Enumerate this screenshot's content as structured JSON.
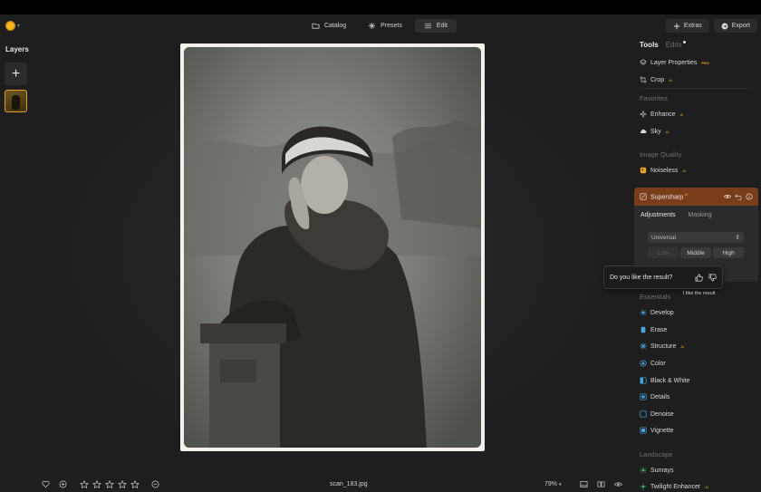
{
  "topbar": {
    "modes": [
      {
        "label": "Catalog",
        "icon": "folder-icon"
      },
      {
        "label": "Presets",
        "icon": "sparkle-icon"
      },
      {
        "label": "Edit",
        "icon": "sliders-icon",
        "active": true
      }
    ],
    "extras_label": "Extras",
    "export_label": "Export"
  },
  "layers": {
    "title": "Layers",
    "add_symbol": "+"
  },
  "panel": {
    "tabs": {
      "tools": "Tools",
      "edits": "Edits"
    },
    "items_top": [
      {
        "label": "Layer Properties",
        "badge": "PRO",
        "icon": "layers-icon"
      },
      {
        "label": "Crop",
        "badge": "AI",
        "icon": "crop-icon"
      }
    ],
    "favorites": {
      "title": "Favorites",
      "items": [
        {
          "label": "Enhance",
          "badge": "AI",
          "icon": "enhance-icon"
        },
        {
          "label": "Sky",
          "badge": "AI",
          "icon": "cloud-icon"
        }
      ]
    },
    "image_quality": {
      "title": "Image Quality",
      "items": [
        {
          "label": "Noiseless",
          "badge": "AI",
          "icon": "noiseless-icon"
        }
      ]
    },
    "supersharp": {
      "title": "Supersharp",
      "badge": "AI",
      "tabs": [
        "Adjustments",
        "Masking"
      ],
      "mode_select": "Universal",
      "levels": [
        "Low",
        "Middle",
        "High"
      ]
    },
    "essentials": {
      "title": "Essentials",
      "items": [
        {
          "label": "Develop",
          "icon": "develop-icon"
        },
        {
          "label": "Erase",
          "icon": "erase-icon"
        },
        {
          "label": "Structure",
          "badge": "AI",
          "icon": "structure-icon"
        },
        {
          "label": "Color",
          "icon": "color-icon"
        },
        {
          "label": "Black & White",
          "icon": "black-white-icon"
        },
        {
          "label": "Details",
          "icon": "details-icon"
        },
        {
          "label": "Denoise",
          "icon": "denoise-icon"
        },
        {
          "label": "Vignette",
          "icon": "vignette-icon"
        }
      ]
    },
    "landscape": {
      "title": "Landscape",
      "items": [
        {
          "label": "Sunrays",
          "icon": "sunrays-icon"
        },
        {
          "label": "Twilight Enhancer",
          "badge": "AI",
          "icon": "twilight-icon"
        }
      ]
    }
  },
  "feedback": {
    "question": "Do you like the result?",
    "tooltip": "I like the result"
  },
  "bottombar": {
    "filename": "scan_183.jpg",
    "zoom": "79%",
    "rating": 0,
    "max_rating": 5
  },
  "colors": {
    "accent": "#e3a020",
    "supersharp_header": "#7a3d1c",
    "background": "#1e1e1f"
  }
}
